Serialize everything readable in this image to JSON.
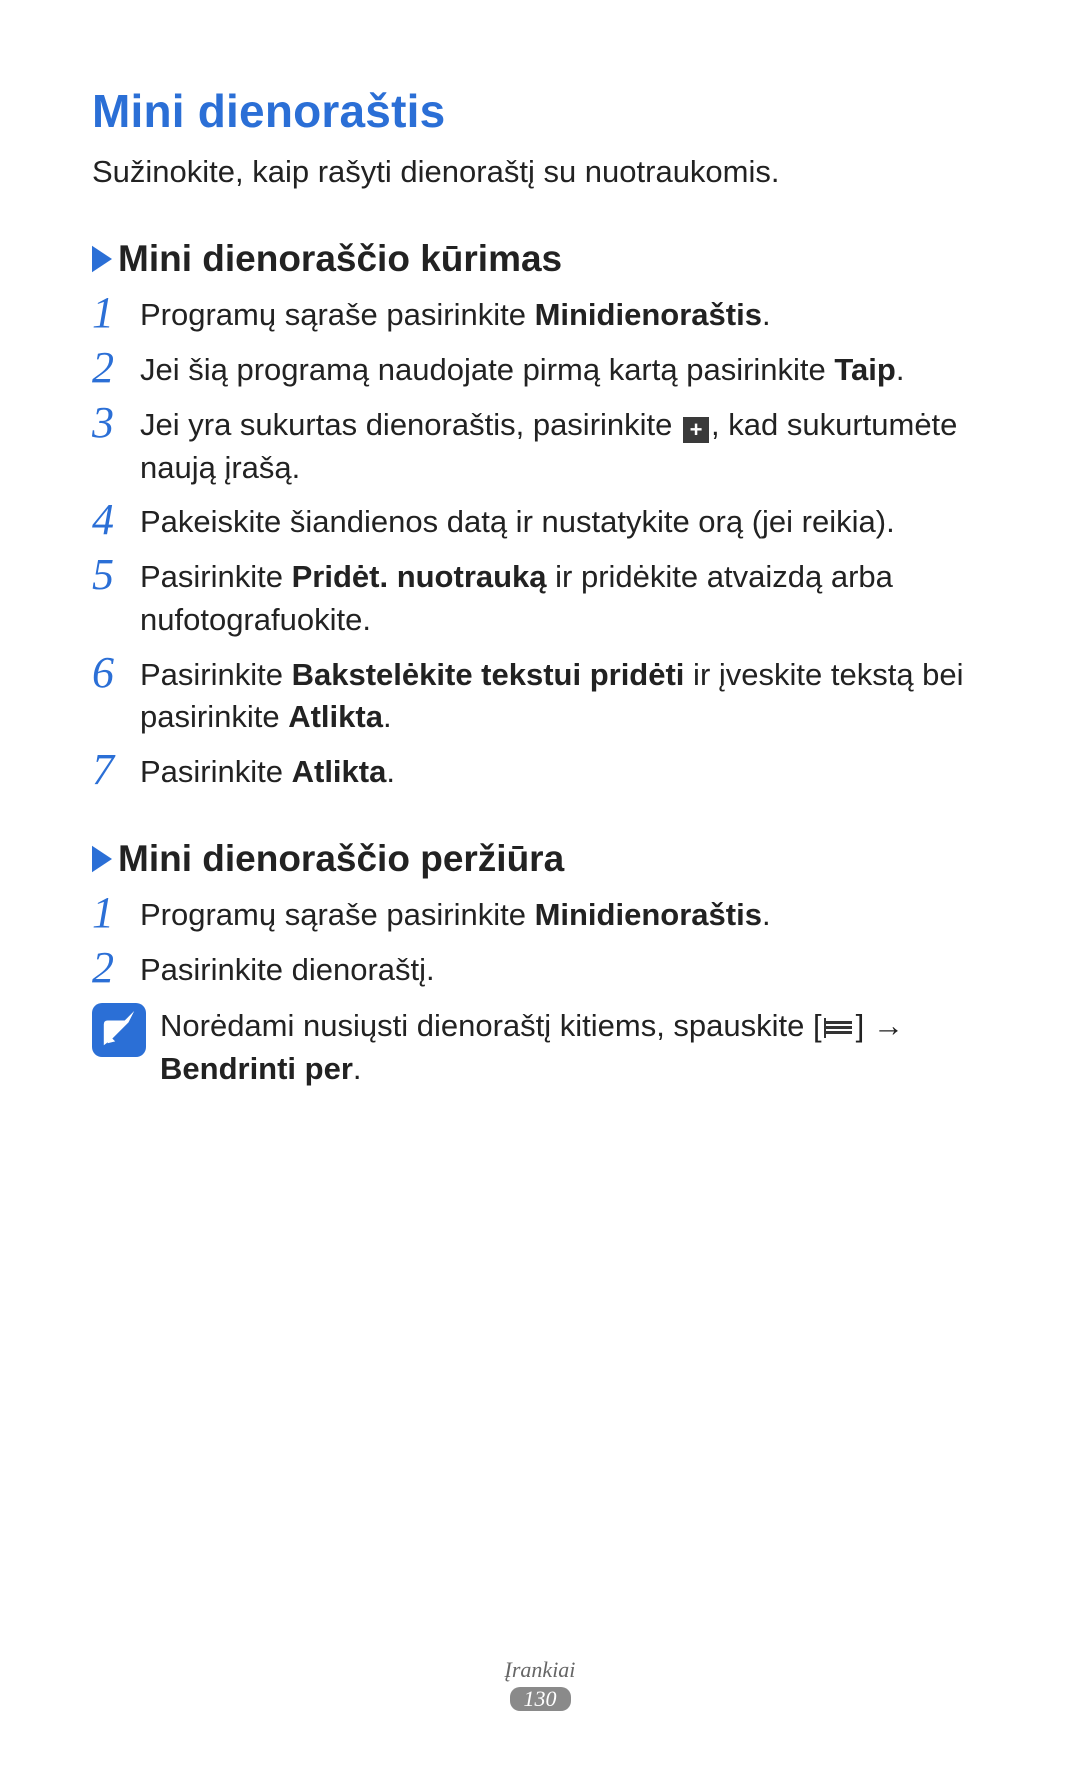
{
  "title": "Mini dienoraštis",
  "intro": "Sužinokite, kaip rašyti dienoraštį su nuotraukomis.",
  "section1": {
    "title": "Mini dienoraščio kūrimas",
    "steps": {
      "s1_pre": "Programų sąraše pasirinkite ",
      "s1_b": "Minidienoraštis",
      "s1_post": ".",
      "s2_pre": "Jei šią programą naudojate pirmą kartą pasirinkite ",
      "s2_b": "Taip",
      "s2_post": ".",
      "s3_pre": "Jei yra sukurtas dienoraštis, pasirinkite ",
      "s3_post": ", kad sukurtumėte naują įrašą.",
      "s4": "Pakeiskite šiandienos datą ir nustatykite orą (jei reikia).",
      "s5_pre": "Pasirinkite ",
      "s5_b": "Pridėt. nuotrauką",
      "s5_post": " ir pridėkite atvaizdą arba nufotografuokite.",
      "s6_pre": "Pasirinkite ",
      "s6_b1": "Bakstelėkite tekstui pridėti",
      "s6_mid": " ir įveskite tekstą bei pasirinkite ",
      "s6_b2": "Atlikta",
      "s6_post": ".",
      "s7_pre": "Pasirinkite ",
      "s7_b": "Atlikta",
      "s7_post": "."
    }
  },
  "section2": {
    "title": "Mini dienoraščio peržiūra",
    "steps": {
      "s1_pre": "Programų sąraše pasirinkite ",
      "s1_b": "Minidienoraštis",
      "s1_post": ".",
      "s2": "Pasirinkite dienoraštį."
    },
    "note_pre": "Norėdami nusiųsti dienoraštį kitiems, spauskite [",
    "note_mid": "] ",
    "note_arrow": "→",
    "note_b": "Bendrinti per",
    "note_post": "."
  },
  "nums": {
    "n1": "1",
    "n2": "2",
    "n3": "3",
    "n4": "4",
    "n5": "5",
    "n6": "6",
    "n7": "7"
  },
  "plus_glyph": "+",
  "footer": {
    "category": "Įrankiai",
    "page": "130"
  }
}
